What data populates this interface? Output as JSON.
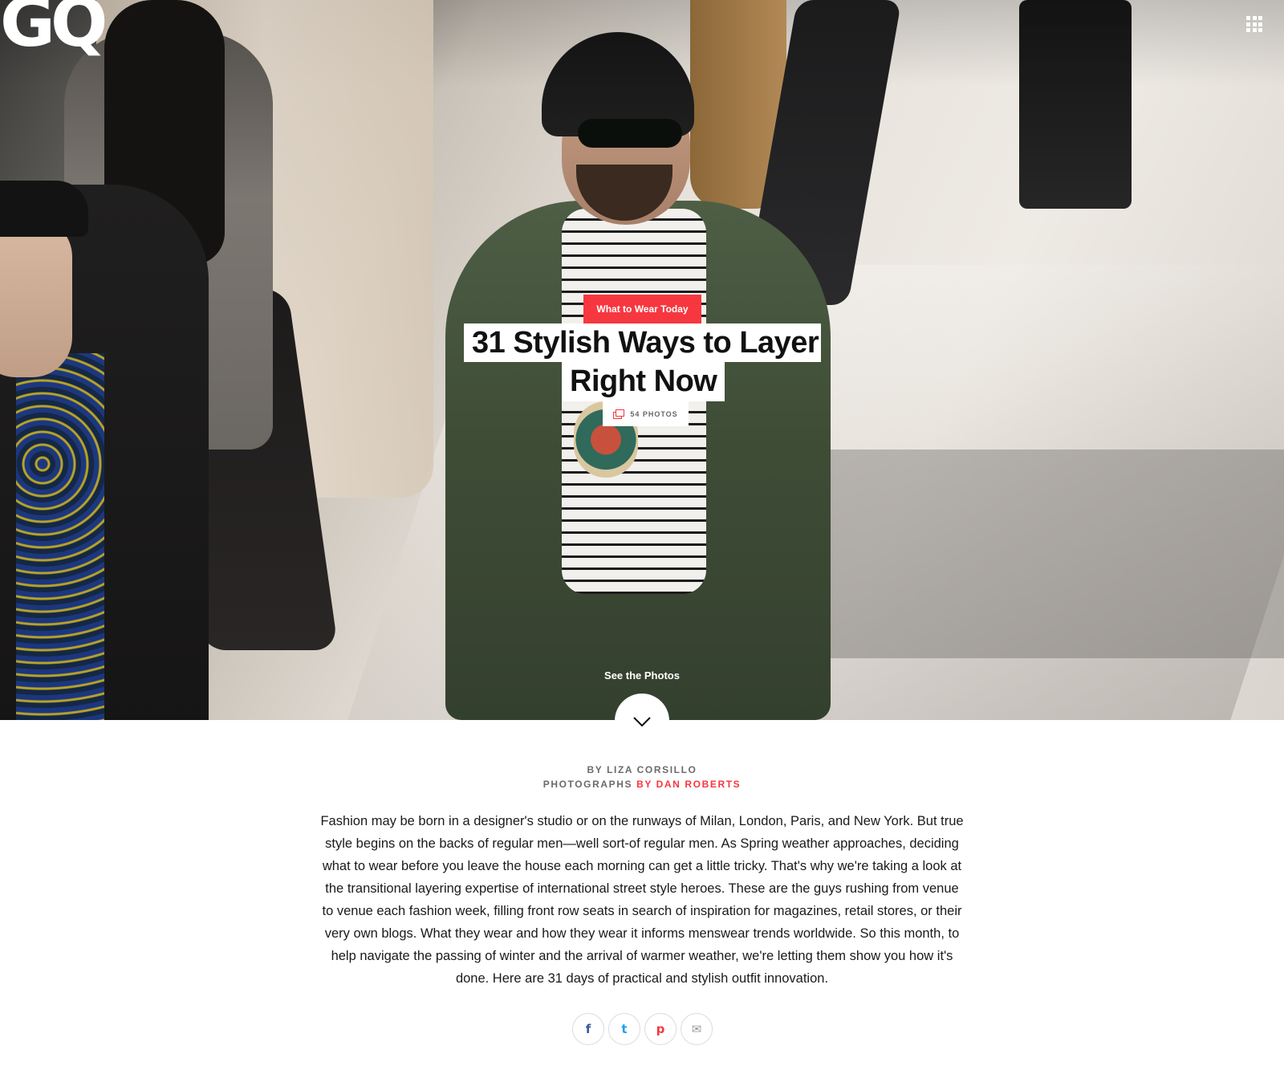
{
  "header": {
    "logo": "GQ",
    "menu_icon": "grid-menu-icon"
  },
  "hero": {
    "kicker": "What to Wear Today",
    "title_line_1": "31 Stylish Ways to Layer",
    "title_line_2": "Right Now",
    "photo_count": "54 PHOTOS",
    "photo_count_icon": "gallery-icon",
    "see_photos_label": "See the Photos",
    "scroll_icon": "chevron-down-icon"
  },
  "byline": {
    "author": "BY LIZA CORSILLO",
    "photographs_label": "PHOTOGRAPHS",
    "photographer": "BY DAN ROBERTS"
  },
  "dek": "Fashion may be born in a designer's studio or on the runways of Milan, London, Paris, and New York. But true style begins on the backs of regular men—well sort-of regular men. As Spring weather approaches, deciding what to wear before you leave the house each morning can get a little tricky. That's why we're taking a look at the transitional layering expertise of international street style heroes. These are the guys rushing from venue to venue each fashion week, filling front row seats in search of inspiration for magazines, retail stores, or their very own blogs. What they wear and how they wear it informs menswear trends worldwide. So this month, to help navigate the passing of winter and the arrival of warmer weather, we're letting them show you how it's done. Here are 31 days of practical and stylish outfit innovation.",
  "share": {
    "facebook_glyph": "f",
    "twitter_glyph": "t",
    "pinterest_glyph": "p",
    "email_glyph": "✉"
  },
  "colors": {
    "accent": "#f6373f",
    "text": "#1a1a1a",
    "byline_gray": "#6b6b6b"
  }
}
